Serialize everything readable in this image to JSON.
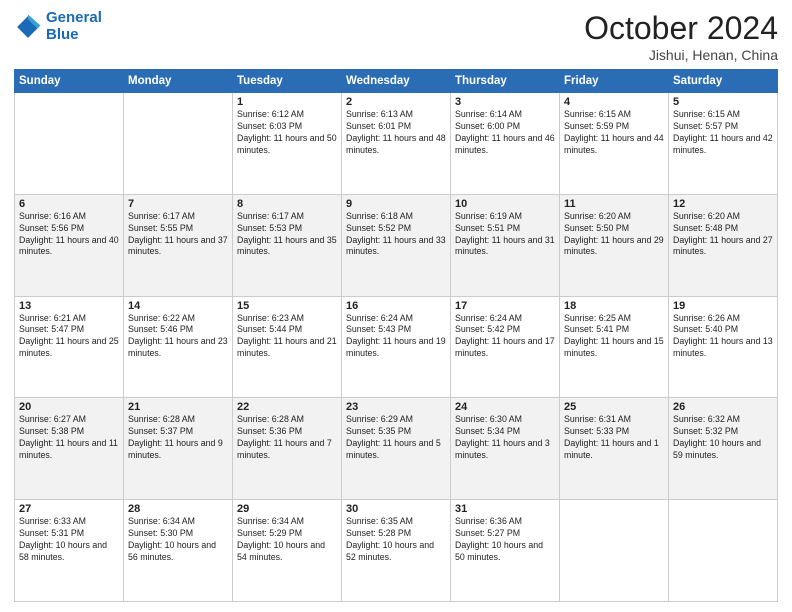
{
  "header": {
    "logo_line1": "General",
    "logo_line2": "Blue",
    "month_year": "October 2024",
    "location": "Jishui, Henan, China"
  },
  "days_of_week": [
    "Sunday",
    "Monday",
    "Tuesday",
    "Wednesday",
    "Thursday",
    "Friday",
    "Saturday"
  ],
  "weeks": [
    [
      {
        "day": "",
        "info": ""
      },
      {
        "day": "",
        "info": ""
      },
      {
        "day": "1",
        "info": "Sunrise: 6:12 AM\nSunset: 6:03 PM\nDaylight: 11 hours and 50 minutes."
      },
      {
        "day": "2",
        "info": "Sunrise: 6:13 AM\nSunset: 6:01 PM\nDaylight: 11 hours and 48 minutes."
      },
      {
        "day": "3",
        "info": "Sunrise: 6:14 AM\nSunset: 6:00 PM\nDaylight: 11 hours and 46 minutes."
      },
      {
        "day": "4",
        "info": "Sunrise: 6:15 AM\nSunset: 5:59 PM\nDaylight: 11 hours and 44 minutes."
      },
      {
        "day": "5",
        "info": "Sunrise: 6:15 AM\nSunset: 5:57 PM\nDaylight: 11 hours and 42 minutes."
      }
    ],
    [
      {
        "day": "6",
        "info": "Sunrise: 6:16 AM\nSunset: 5:56 PM\nDaylight: 11 hours and 40 minutes."
      },
      {
        "day": "7",
        "info": "Sunrise: 6:17 AM\nSunset: 5:55 PM\nDaylight: 11 hours and 37 minutes."
      },
      {
        "day": "8",
        "info": "Sunrise: 6:17 AM\nSunset: 5:53 PM\nDaylight: 11 hours and 35 minutes."
      },
      {
        "day": "9",
        "info": "Sunrise: 6:18 AM\nSunset: 5:52 PM\nDaylight: 11 hours and 33 minutes."
      },
      {
        "day": "10",
        "info": "Sunrise: 6:19 AM\nSunset: 5:51 PM\nDaylight: 11 hours and 31 minutes."
      },
      {
        "day": "11",
        "info": "Sunrise: 6:20 AM\nSunset: 5:50 PM\nDaylight: 11 hours and 29 minutes."
      },
      {
        "day": "12",
        "info": "Sunrise: 6:20 AM\nSunset: 5:48 PM\nDaylight: 11 hours and 27 minutes."
      }
    ],
    [
      {
        "day": "13",
        "info": "Sunrise: 6:21 AM\nSunset: 5:47 PM\nDaylight: 11 hours and 25 minutes."
      },
      {
        "day": "14",
        "info": "Sunrise: 6:22 AM\nSunset: 5:46 PM\nDaylight: 11 hours and 23 minutes."
      },
      {
        "day": "15",
        "info": "Sunrise: 6:23 AM\nSunset: 5:44 PM\nDaylight: 11 hours and 21 minutes."
      },
      {
        "day": "16",
        "info": "Sunrise: 6:24 AM\nSunset: 5:43 PM\nDaylight: 11 hours and 19 minutes."
      },
      {
        "day": "17",
        "info": "Sunrise: 6:24 AM\nSunset: 5:42 PM\nDaylight: 11 hours and 17 minutes."
      },
      {
        "day": "18",
        "info": "Sunrise: 6:25 AM\nSunset: 5:41 PM\nDaylight: 11 hours and 15 minutes."
      },
      {
        "day": "19",
        "info": "Sunrise: 6:26 AM\nSunset: 5:40 PM\nDaylight: 11 hours and 13 minutes."
      }
    ],
    [
      {
        "day": "20",
        "info": "Sunrise: 6:27 AM\nSunset: 5:38 PM\nDaylight: 11 hours and 11 minutes."
      },
      {
        "day": "21",
        "info": "Sunrise: 6:28 AM\nSunset: 5:37 PM\nDaylight: 11 hours and 9 minutes."
      },
      {
        "day": "22",
        "info": "Sunrise: 6:28 AM\nSunset: 5:36 PM\nDaylight: 11 hours and 7 minutes."
      },
      {
        "day": "23",
        "info": "Sunrise: 6:29 AM\nSunset: 5:35 PM\nDaylight: 11 hours and 5 minutes."
      },
      {
        "day": "24",
        "info": "Sunrise: 6:30 AM\nSunset: 5:34 PM\nDaylight: 11 hours and 3 minutes."
      },
      {
        "day": "25",
        "info": "Sunrise: 6:31 AM\nSunset: 5:33 PM\nDaylight: 11 hours and 1 minute."
      },
      {
        "day": "26",
        "info": "Sunrise: 6:32 AM\nSunset: 5:32 PM\nDaylight: 10 hours and 59 minutes."
      }
    ],
    [
      {
        "day": "27",
        "info": "Sunrise: 6:33 AM\nSunset: 5:31 PM\nDaylight: 10 hours and 58 minutes."
      },
      {
        "day": "28",
        "info": "Sunrise: 6:34 AM\nSunset: 5:30 PM\nDaylight: 10 hours and 56 minutes."
      },
      {
        "day": "29",
        "info": "Sunrise: 6:34 AM\nSunset: 5:29 PM\nDaylight: 10 hours and 54 minutes."
      },
      {
        "day": "30",
        "info": "Sunrise: 6:35 AM\nSunset: 5:28 PM\nDaylight: 10 hours and 52 minutes."
      },
      {
        "day": "31",
        "info": "Sunrise: 6:36 AM\nSunset: 5:27 PM\nDaylight: 10 hours and 50 minutes."
      },
      {
        "day": "",
        "info": ""
      },
      {
        "day": "",
        "info": ""
      }
    ]
  ]
}
